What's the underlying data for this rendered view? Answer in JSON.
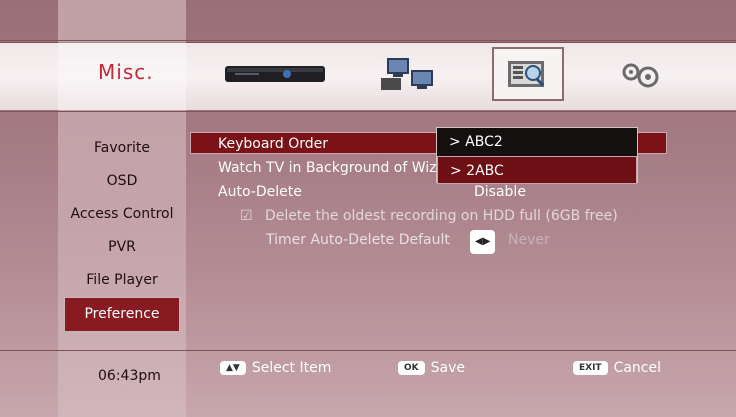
{
  "header": {
    "title": "Misc.",
    "icons": [
      "set-top-box-icon",
      "network-computers-icon",
      "search-media-icon",
      "settings-gears-icon"
    ],
    "selected_icon": "search-media-icon"
  },
  "sidebar": {
    "items": [
      {
        "label": "Favorite"
      },
      {
        "label": "OSD"
      },
      {
        "label": "Access Control"
      },
      {
        "label": "PVR"
      },
      {
        "label": "File Player"
      },
      {
        "label": "Preference"
      }
    ],
    "active_index": 5
  },
  "settings": {
    "rows": [
      {
        "label": "Keyboard Order"
      },
      {
        "label": "Watch TV in Background of Wiz"
      },
      {
        "label": "Auto-Delete",
        "value": "Disable"
      },
      {
        "label": "Delete the oldest recording on HDD full (6GB free)"
      },
      {
        "label": "Timer Auto-Delete Default",
        "value": "Never"
      }
    ]
  },
  "dropdown": {
    "options": [
      "> ABC2",
      "> 2ABC"
    ],
    "selected": "> 2ABC"
  },
  "footer": {
    "time": "06:43pm",
    "select_label": "Select Item",
    "ok_label": "Save",
    "cancel_label": "Cancel",
    "ok_key": "OK",
    "exit_key": "EXIT"
  },
  "colors": {
    "accent": "#8a1a22",
    "title_red": "#c22a3a"
  }
}
